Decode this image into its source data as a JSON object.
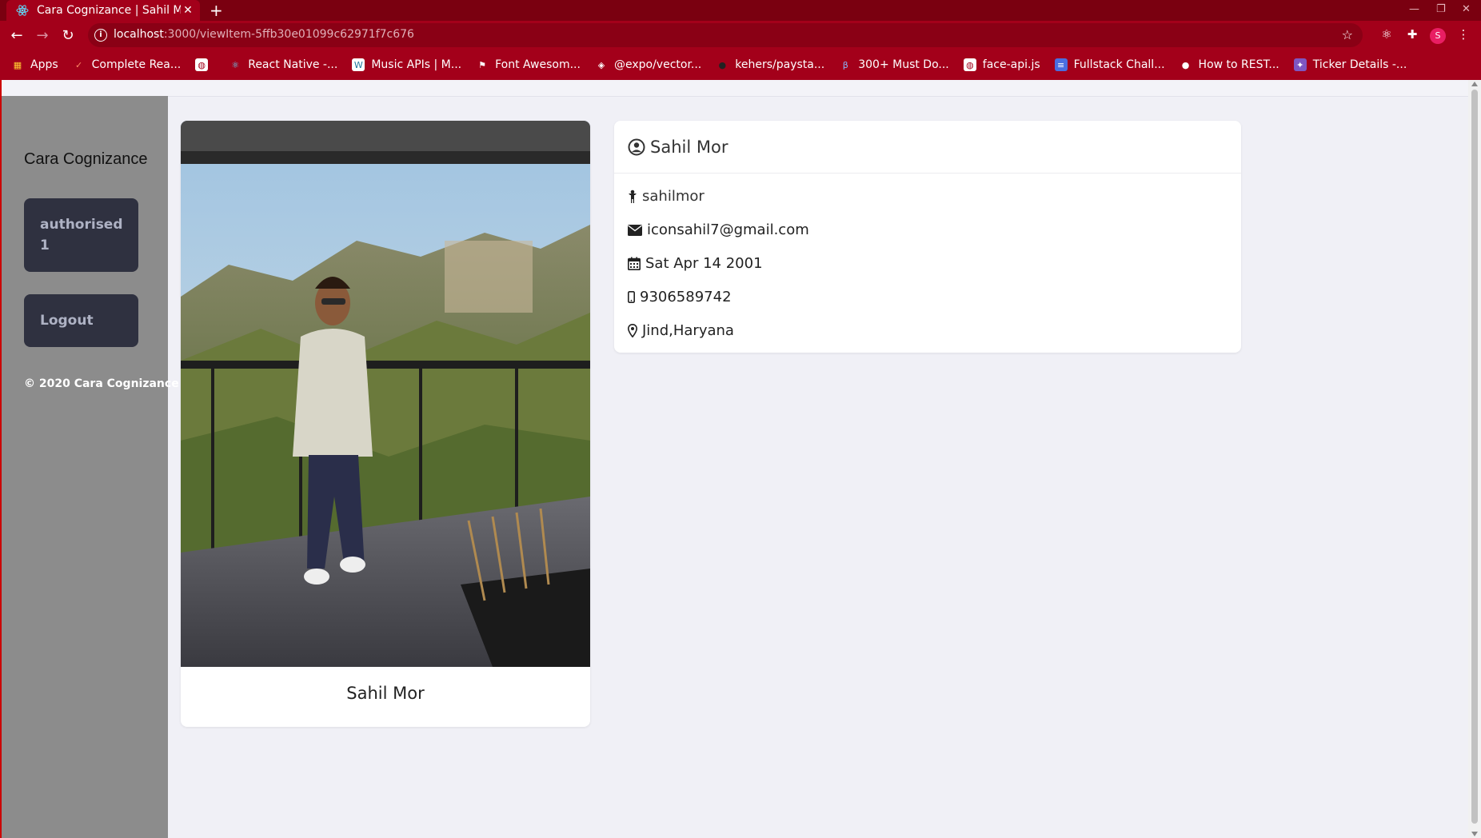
{
  "browser": {
    "tab_title": "Cara Cognizance | Sahil M",
    "url_host": "localhost",
    "url_path": ":3000/viewItem-5ffb30e01099c62971f7c676",
    "profile_initial": "S",
    "bookmarks": [
      {
        "label": "Apps",
        "icon": "apps-grid-icon"
      },
      {
        "label": "Complete Rea...",
        "icon": "bookmark-icon"
      },
      {
        "label": "",
        "icon": "globe-icon"
      },
      {
        "label": "React Native -...",
        "icon": "react-icon"
      },
      {
        "label": "Music APIs | M...",
        "icon": "wordpress-icon"
      },
      {
        "label": "Font Awesom...",
        "icon": "flag-icon"
      },
      {
        "label": "@expo/vector...",
        "icon": "expo-icon"
      },
      {
        "label": "kehers/paysta...",
        "icon": "github-icon"
      },
      {
        "label": "300+ Must Do...",
        "icon": "beta-icon"
      },
      {
        "label": "face-api.js",
        "icon": "globe-icon"
      },
      {
        "label": "Fullstack Chall...",
        "icon": "doc-icon"
      },
      {
        "label": "How to REST...",
        "icon": "medium-icon"
      },
      {
        "label": "Ticker Details -...",
        "icon": "bulb-icon"
      }
    ]
  },
  "sidebar": {
    "brand": "Cara Cognizance",
    "auth_button": "authorised 1",
    "logout_button": "Logout",
    "copyright": "© 2020 Cara Cognizance"
  },
  "profile_card": {
    "name": "Sahil Mor"
  },
  "details": {
    "name": "Sahil Mor",
    "username": "sahilmor",
    "email": "iconsahil7@gmail.com",
    "dob": "Sat Apr 14 2001",
    "phone": "9306589742",
    "location": "Jind,Haryana"
  },
  "colors": {
    "chrome_accent": "#a3001a",
    "sidebar_bg": "#8c8c8c",
    "button_bg": "#2f3140",
    "page_bg": "#f0f0f6"
  }
}
